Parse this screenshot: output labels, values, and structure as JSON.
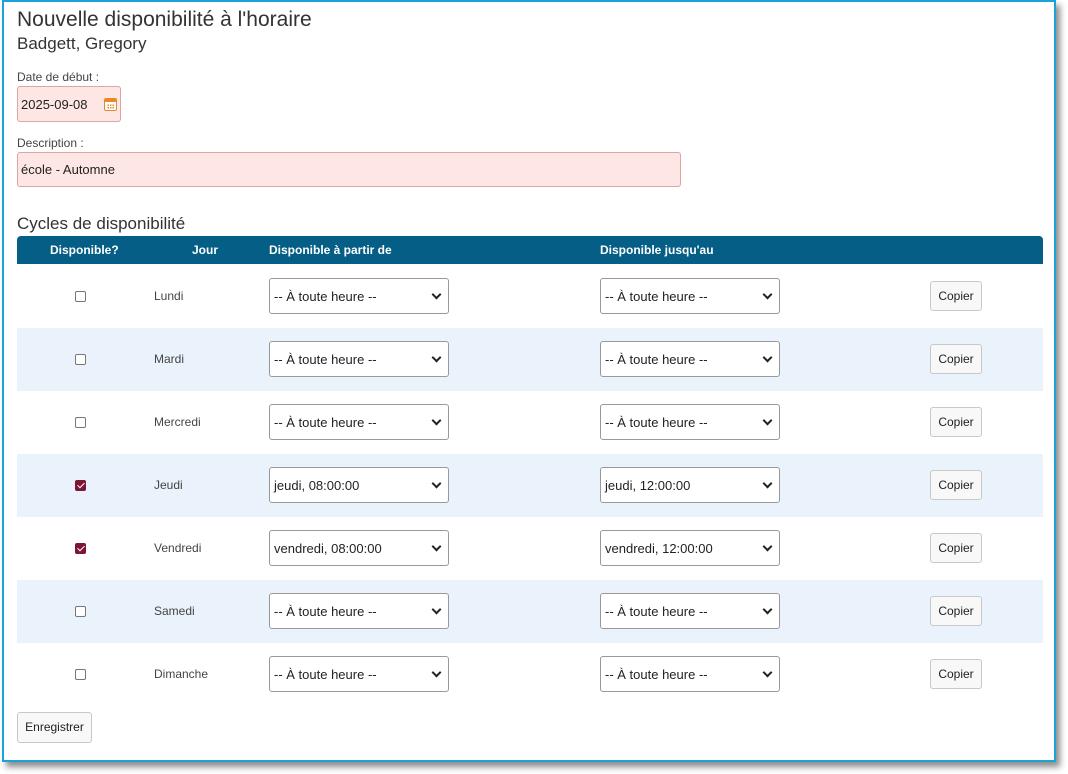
{
  "header": {
    "title": "Nouvelle disponibilité à l'horaire",
    "employee": "Badgett, Gregory"
  },
  "form": {
    "start_date_label": "Date de début :",
    "start_date_value": "2025-09-08",
    "description_label": "Description :",
    "description_value": "école - Automne"
  },
  "cycles": {
    "section_title": "Cycles de disponibilité",
    "columns": [
      "Disponible?",
      "Jour",
      "Disponible à partir de",
      "Disponible jusqu'au"
    ],
    "copy_label": "Copier",
    "rows": [
      {
        "day": "Lundi",
        "available": false,
        "from": "-- À toute heure --",
        "to": "-- À toute heure --"
      },
      {
        "day": "Mardi",
        "available": false,
        "from": "-- À toute heure --",
        "to": "-- À toute heure --"
      },
      {
        "day": "Mercredi",
        "available": false,
        "from": "-- À toute heure --",
        "to": "-- À toute heure --"
      },
      {
        "day": "Jeudi",
        "available": true,
        "from": "jeudi, 08:00:00",
        "to": "jeudi, 12:00:00"
      },
      {
        "day": "Vendredi",
        "available": true,
        "from": "vendredi, 08:00:00",
        "to": "vendredi, 12:00:00"
      },
      {
        "day": "Samedi",
        "available": false,
        "from": "-- À toute heure --",
        "to": "-- À toute heure --"
      },
      {
        "day": "Dimanche",
        "available": false,
        "from": "-- À toute heure --",
        "to": "-- À toute heure --"
      }
    ]
  },
  "actions": {
    "save_label": "Enregistrer"
  },
  "colors": {
    "header_bg": "#045e86",
    "checked": "#7d1535",
    "required_bg": "#fde6e4",
    "alt_row": "#eaf3fb"
  }
}
